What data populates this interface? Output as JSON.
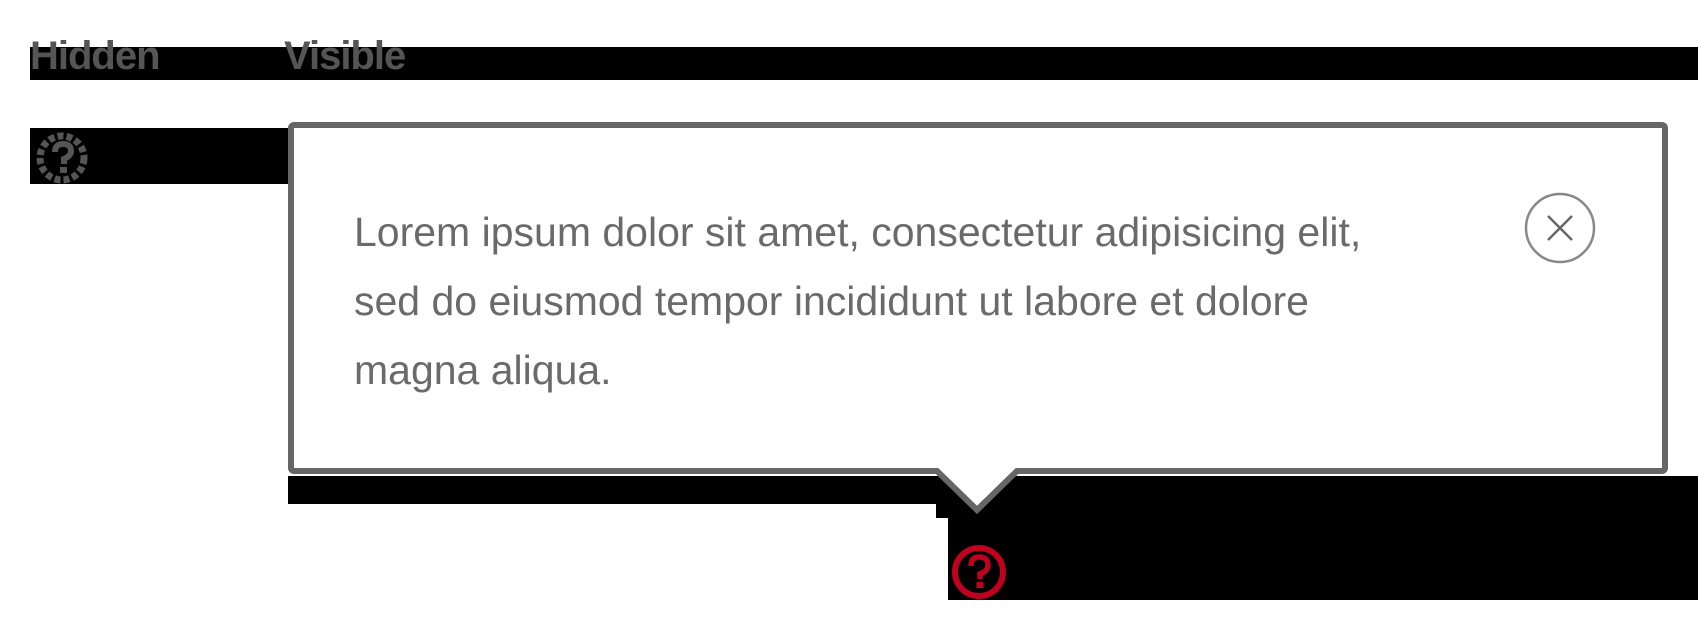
{
  "header": {
    "hidden_label": "Hidden",
    "visible_label": "Visible"
  },
  "popover": {
    "text": "Lorem ipsum dolor sit amet, consectetur adipisicing elit, sed do eiusmod tempor incididunt ut labore et dolore magna aliqua.",
    "close_icon": "close-icon"
  },
  "icons": {
    "hidden_help": "question-circle-icon",
    "visible_help": "question-circle-icon"
  },
  "colors": {
    "text": "#6a6a6a",
    "border": "#666666",
    "help_hidden": "#444444",
    "help_active": "#c0001f"
  }
}
